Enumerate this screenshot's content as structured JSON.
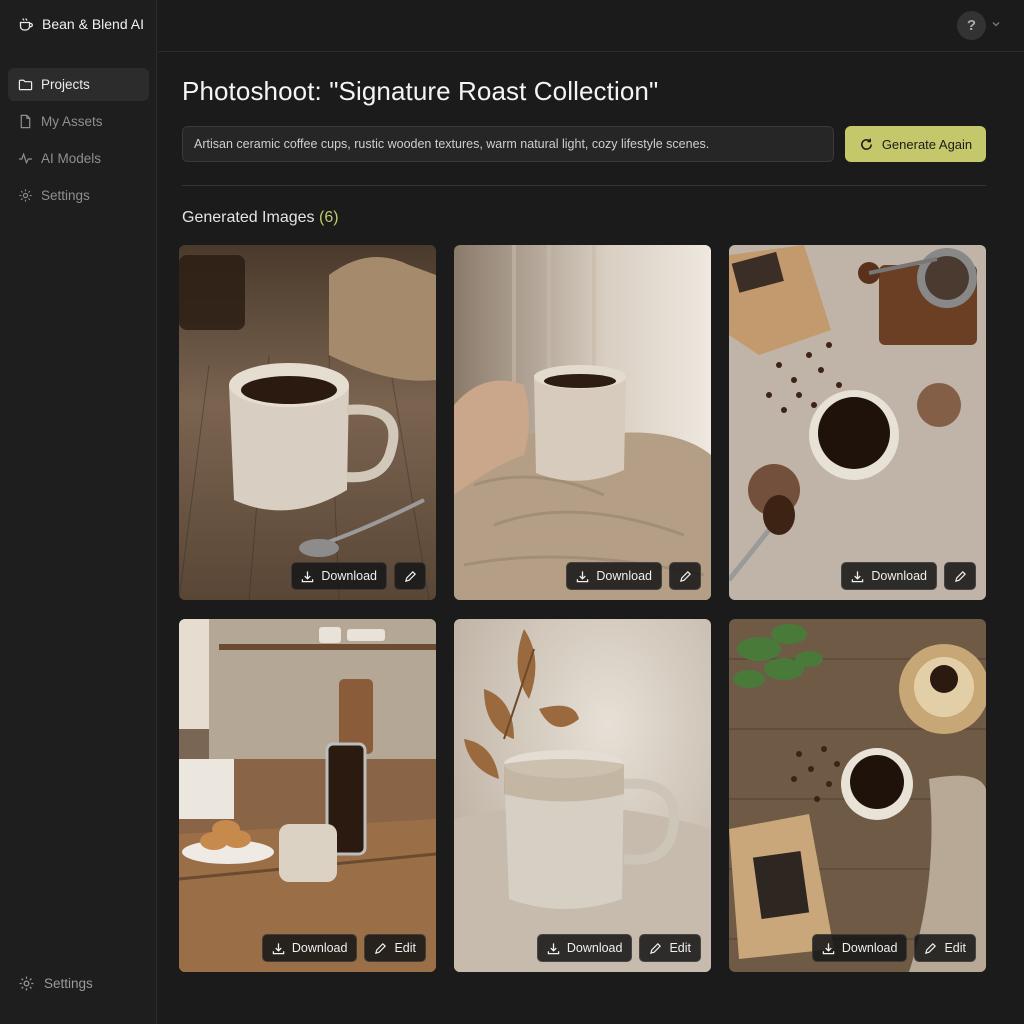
{
  "app": {
    "name": "Bean & Blend AI"
  },
  "sidebar": {
    "items": [
      {
        "label": "Projects",
        "icon": "folder-icon",
        "active": true
      },
      {
        "label": "My Assets",
        "icon": "file-icon",
        "active": false
      },
      {
        "label": "AI Models",
        "icon": "pulse-icon",
        "active": false
      },
      {
        "label": "Settings",
        "icon": "gear-icon",
        "active": false
      }
    ],
    "bottom_label": "Settings"
  },
  "header": {
    "help_label": "?"
  },
  "main": {
    "title": "Photoshoot: \"Signature Roast Collection\"",
    "prompt": "Artisan ceramic coffee cups, rustic wooden textures, warm natural light, cozy lifestyle scenes.",
    "generate_label": "Generate Again",
    "section_title": "Generated Images",
    "count": "(6)"
  },
  "images": [
    {
      "download_label": "Download",
      "edit_label": ""
    },
    {
      "download_label": "Download",
      "edit_label": ""
    },
    {
      "download_label": "Download",
      "edit_label": ""
    },
    {
      "download_label": "Download",
      "edit_label": "Edit"
    },
    {
      "download_label": "Download",
      "edit_label": "Edit"
    },
    {
      "download_label": "Download",
      "edit_label": "Edit"
    }
  ],
  "colors": {
    "accent": "#c5c76b",
    "background": "#1b1b1b",
    "sidebar": "#1e1e1e"
  }
}
